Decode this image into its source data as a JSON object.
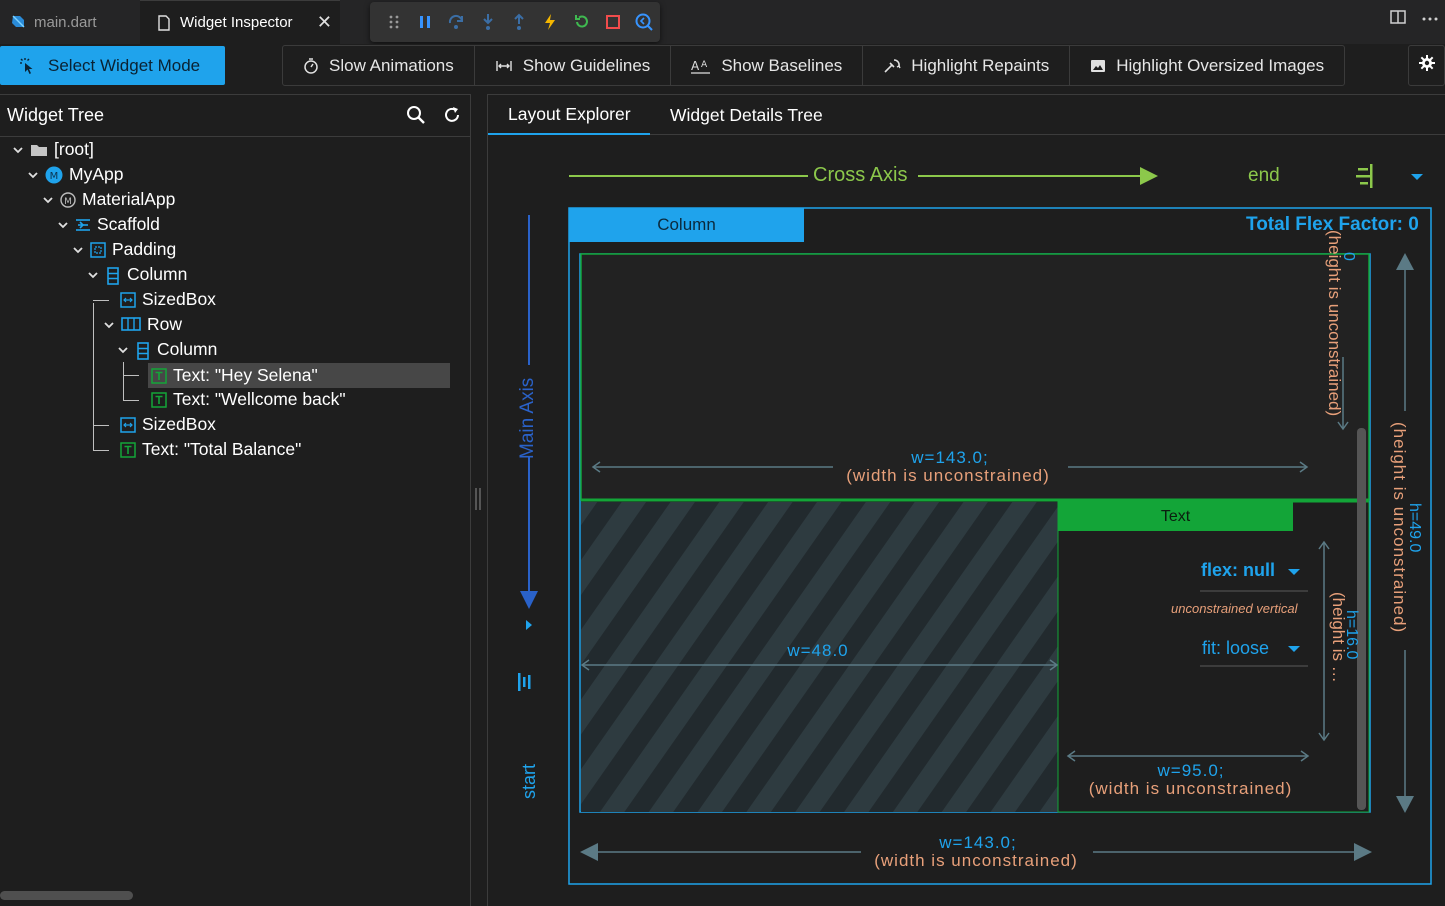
{
  "tabs": {
    "main_dart": "main.dart",
    "inspector": "Widget Inspector"
  },
  "toolbar": {
    "select_widget_mode": "Select Widget Mode",
    "slow_animations": "Slow Animations",
    "show_guidelines": "Show Guidelines",
    "show_baselines": "Show Baselines",
    "highlight_repaints": "Highlight Repaints",
    "highlight_oversized_images": "Highlight Oversized Images"
  },
  "widget_tree": {
    "title": "Widget Tree",
    "nodes": [
      {
        "label": "[root]",
        "icon": "folder-icon"
      },
      {
        "label": "MyApp",
        "icon": "my-app-icon"
      },
      {
        "label": "MaterialApp",
        "icon": "material-app-icon"
      },
      {
        "label": "Scaffold",
        "icon": "scaffold-icon"
      },
      {
        "label": "Padding",
        "icon": "padding-icon"
      },
      {
        "label": "Column",
        "icon": "column-icon"
      },
      {
        "label": "SizedBox",
        "icon": "sizedbox-icon"
      },
      {
        "label": "Row",
        "icon": "row-icon"
      },
      {
        "label": "Column",
        "icon": "column-icon"
      },
      {
        "label": "Text: \"Hey Selena\"",
        "icon": "text-widget-icon"
      },
      {
        "label": "Text: \"Wellcome back\"",
        "icon": "text-widget-icon"
      },
      {
        "label": "SizedBox",
        "icon": "sizedbox-icon"
      },
      {
        "label": "Text: \"Total Balance\"",
        "icon": "text-widget-icon"
      }
    ],
    "selected_index": 9
  },
  "details_tabs": {
    "layout_explorer": "Layout Explorer",
    "widget_details_tree": "Widget Details Tree"
  },
  "layout": {
    "cross_axis_label": "Cross Axis",
    "cross_axis_alignment": "end",
    "main_axis_label": "Main Axis",
    "main_axis_alignment": "start",
    "widget_label": "Column",
    "total_flex_factor": "Total Flex Factor: 0",
    "top_child_height_value": "0",
    "top_child_height_note": "(height is unconstrained)",
    "top_child_width_value": "w=143.0;",
    "top_child_width_note": "(width is unconstrained)",
    "child_label": "Text",
    "flex_value": "flex: null",
    "unconstrained_note": "unconstrained vertical",
    "fit_value": "fit: loose",
    "text_height_value": "h=16.0",
    "text_height_note": "(height is …",
    "text_width_value": "w=95.0;",
    "text_width_note": "(width is unconstrained)",
    "empty_width_value": "w=48.0",
    "column_height_value": "h=49.0",
    "column_height_note": "(height is unconstrained)",
    "outer_width_value": "w=143.0;",
    "outer_width_note": "(width is unconstrained)"
  },
  "colors": {
    "accent": "#1fa3ec",
    "green": "#13a538",
    "axis_green": "#8cc84b",
    "dimension_orange": "#e8a07a"
  }
}
